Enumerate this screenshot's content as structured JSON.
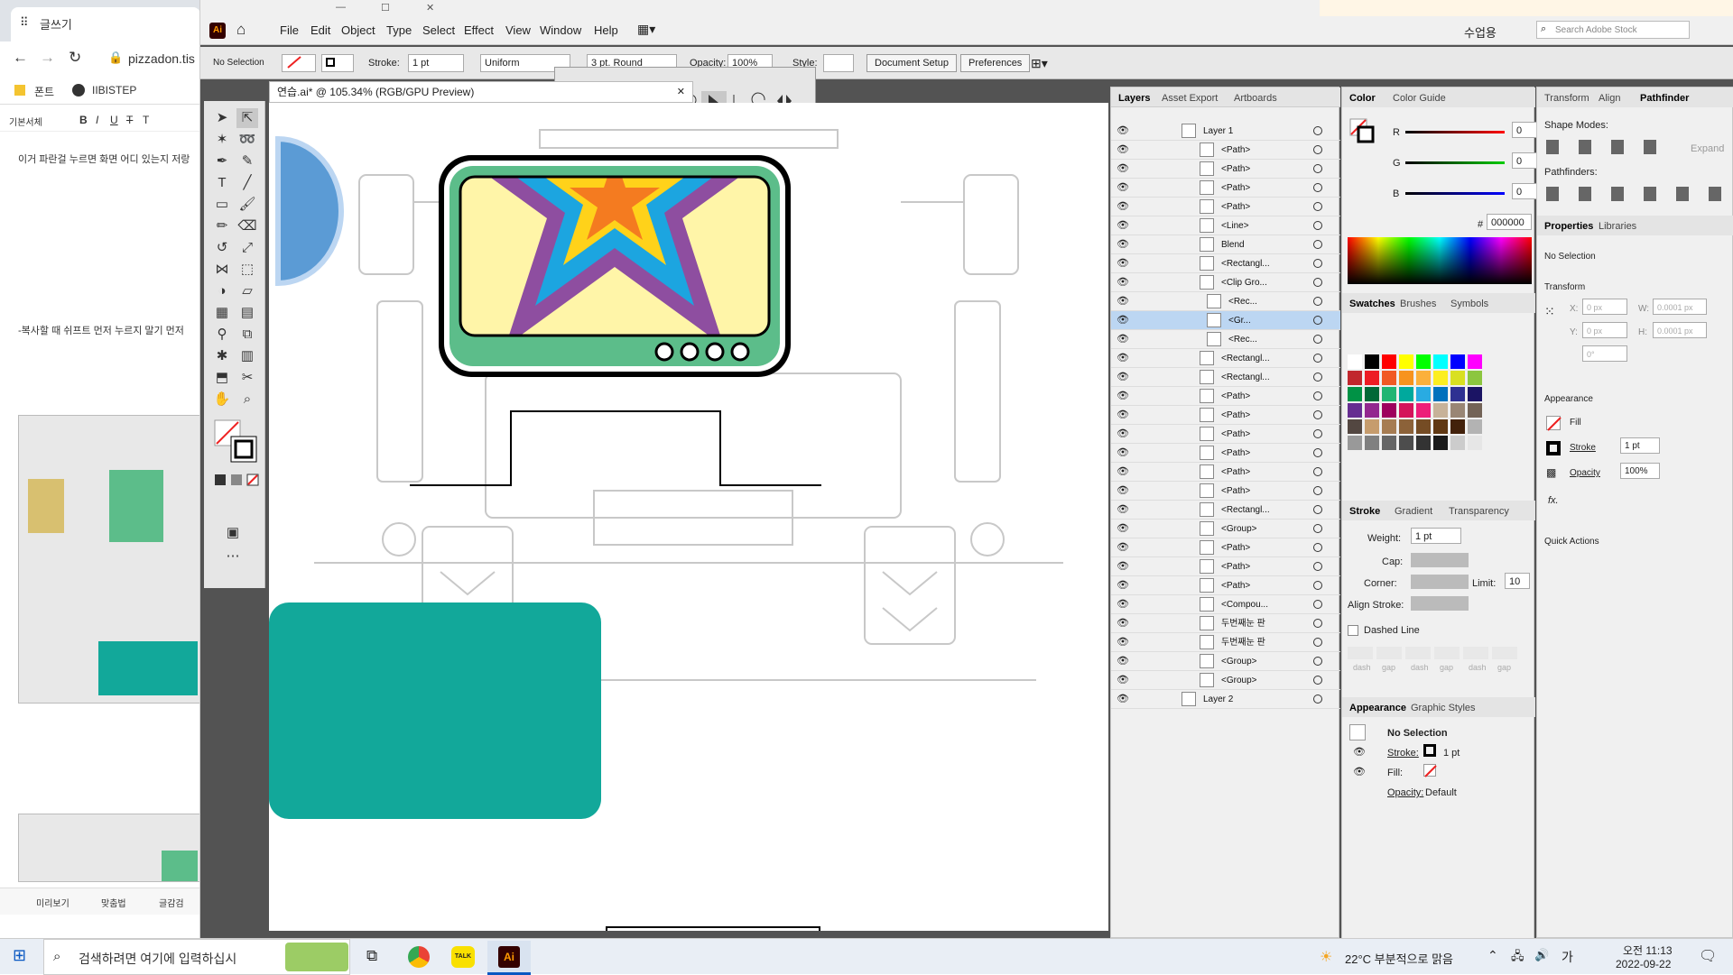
{
  "browser": {
    "tab_title": "글쓰기",
    "address": "pizzadon.tis",
    "bookmark1": "폰트",
    "bookmark2": "IIBISTEP",
    "editor_tab": "기본서체",
    "text1": "이거 파란걸 누르면 화면 어디 있는지 저랑",
    "text2": "-복사할 때 쉬프트 먼저 누르지 말기 먼저",
    "bottom1": "미리보기",
    "bottom2": "맞춤법",
    "bottom3": "글감검"
  },
  "ai": {
    "logo": "Ai",
    "menus": [
      "File",
      "Edit",
      "Object",
      "Type",
      "Select",
      "Effect",
      "View",
      "Window",
      "Help"
    ],
    "workspace": "수업용",
    "search_placeholder": "Search Adobe Stock",
    "control": {
      "selection": "No Selection",
      "stroke_label": "Stroke:",
      "stroke_value": "1 pt",
      "uniform": "Uniform",
      "brush": "3 pt. Round",
      "opacity_label": "Opacity:",
      "opacity_value": "100%",
      "style_label": "Style:",
      "doc_setup": "Document Setup",
      "preferences": "Preferences"
    },
    "doc_tab": "연습.ai* @ 105.34% (RGB/GPU Preview)"
  },
  "layers": {
    "tabs": [
      "Layers",
      "Asset Export",
      "Artboards"
    ],
    "rows": [
      {
        "name": "Layer 1",
        "sel": false
      },
      {
        "name": "<Path>",
        "sel": false
      },
      {
        "name": "<Path>",
        "sel": false
      },
      {
        "name": "<Path>",
        "sel": false
      },
      {
        "name": "<Path>",
        "sel": false
      },
      {
        "name": "<Line>",
        "sel": false
      },
      {
        "name": "Blend",
        "sel": false
      },
      {
        "name": "<Rectangl...",
        "sel": false
      },
      {
        "name": "<Clip Gro...",
        "sel": false
      },
      {
        "name": "<Rec...",
        "sel": false
      },
      {
        "name": "<Gr...",
        "sel": true
      },
      {
        "name": "<Rec...",
        "sel": false
      },
      {
        "name": "<Rectangl...",
        "sel": false
      },
      {
        "name": "<Rectangl...",
        "sel": false
      },
      {
        "name": "<Path>",
        "sel": false
      },
      {
        "name": "<Path>",
        "sel": false
      },
      {
        "name": "<Path>",
        "sel": false
      },
      {
        "name": "<Path>",
        "sel": false
      },
      {
        "name": "<Path>",
        "sel": false
      },
      {
        "name": "<Path>",
        "sel": false
      },
      {
        "name": "<Rectangl...",
        "sel": false
      },
      {
        "name": "<Group>",
        "sel": false
      },
      {
        "name": "<Path>",
        "sel": false
      },
      {
        "name": "<Path>",
        "sel": false
      },
      {
        "name": "<Path>",
        "sel": false
      },
      {
        "name": "<Compou...",
        "sel": false
      },
      {
        "name": "두번째눈 판",
        "sel": false
      },
      {
        "name": "두번째눈 판",
        "sel": false
      },
      {
        "name": "<Group>",
        "sel": false
      },
      {
        "name": "<Group>",
        "sel": false
      },
      {
        "name": "Layer 2",
        "sel": false
      }
    ]
  },
  "color": {
    "tabs": [
      "Color",
      "Color Guide"
    ],
    "r_label": "R",
    "g_label": "G",
    "b_label": "B",
    "r": "0",
    "g": "0",
    "b": "0",
    "hash": "#",
    "hex": "000000"
  },
  "swatches": {
    "tabs": [
      "Swatches",
      "Brushes",
      "Symbols"
    ]
  },
  "stroke": {
    "tabs": [
      "Stroke",
      "Gradient",
      "Transparency"
    ],
    "weight_label": "Weight:",
    "weight": "1 pt",
    "cap_label": "Cap:",
    "corner_label": "Corner:",
    "limit_label": "Limit:",
    "limit": "10",
    "align_label": "Align Stroke:",
    "dashed": "Dashed Line",
    "dash_labels": [
      "dash",
      "gap",
      "dash",
      "gap",
      "dash",
      "gap"
    ]
  },
  "appearance": {
    "tabs": [
      "Appearance",
      "Graphic Styles"
    ],
    "selection": "No Selection",
    "stroke_label": "Stroke:",
    "stroke_value": "1 pt",
    "fill_label": "Fill:",
    "opacity_label": "Opacity:",
    "opacity_value": "Default"
  },
  "right": {
    "tabs": [
      "Transform",
      "Align",
      "Pathfinder"
    ],
    "shape_modes": "Shape Modes:",
    "pathfinders": "Pathfinders:",
    "expand": "Expand",
    "props_tabs": [
      "Properties",
      "Libraries"
    ],
    "no_selection": "No Selection",
    "transform": "Transform",
    "x_label": "X:",
    "y_label": "Y:",
    "w_label": "W:",
    "h_label": "H:",
    "x_val": "0 px",
    "y_val": "0 px",
    "w_val": "0.0001 px",
    "h_val": "0.0001 px",
    "angle": "0°",
    "appearance": "Appearance",
    "fill": "Fill",
    "stroke": "Stroke",
    "stroke_val": "1 pt",
    "opacity": "Opacity",
    "opacity_val": "100%",
    "fx": "fx.",
    "quick_actions": "Quick Actions"
  },
  "taskbar": {
    "search_placeholder": "검색하려면 여기에 입력하십시",
    "weather": "22°C 부분적으로 맑음",
    "ime": "가",
    "time": "오전 11:13",
    "date": "2022-09-22"
  },
  "colors": {
    "green": "#5cbd8a",
    "teal": "#12a89a",
    "purple": "#8e4ea0",
    "blue": "#1ca5e0",
    "yellow": "#ffd21a",
    "orange": "#f47b20",
    "cream": "#fff5a8",
    "sketch": "#c8c8c8"
  }
}
